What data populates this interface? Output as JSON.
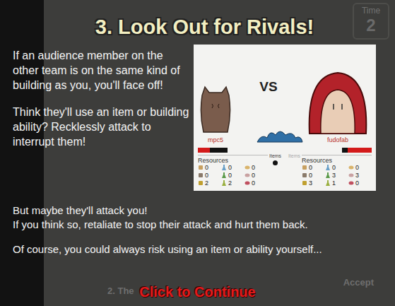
{
  "background": {
    "time_label": "Time",
    "time_value": "2",
    "accept_button": "Accept",
    "step_label": "2. The"
  },
  "title": "3. Look Out for Rivals!",
  "top_paragraphs": [
    {
      "lines": [
        "If an audience member on the other team is on the same kind of building as you, you'll face off!"
      ]
    },
    {
      "lines": [
        "Think they'll use an item or building ability? Recklessly attack to interrupt them!"
      ]
    }
  ],
  "bottom_paragraphs": [
    {
      "lines": [
        "But maybe they'll attack you!",
        "If you think so, retaliate to stop their attack and hurt them back."
      ]
    },
    {
      "lines": [
        "Of course, you could always risk using an item or ability yourself..."
      ]
    }
  ],
  "illustration": {
    "vs": "VS",
    "items_label": "Items",
    "players": [
      {
        "name": "mpc5",
        "side": "left",
        "health": 0.4,
        "items_active": true,
        "has_bomb": true,
        "resources_label": "Resources",
        "resources": [
          "0",
          "0",
          "0",
          "0",
          "0",
          "0",
          "2",
          "2",
          "0"
        ]
      },
      {
        "name": "fudofab",
        "side": "right",
        "health": 0.8,
        "items_active": false,
        "has_bomb": false,
        "resources_label": "Resources",
        "resources": [
          "0",
          "0",
          "0",
          "0",
          "3",
          "3",
          "3",
          "1",
          "0"
        ]
      }
    ]
  },
  "continue_button": "Click to Continue"
}
